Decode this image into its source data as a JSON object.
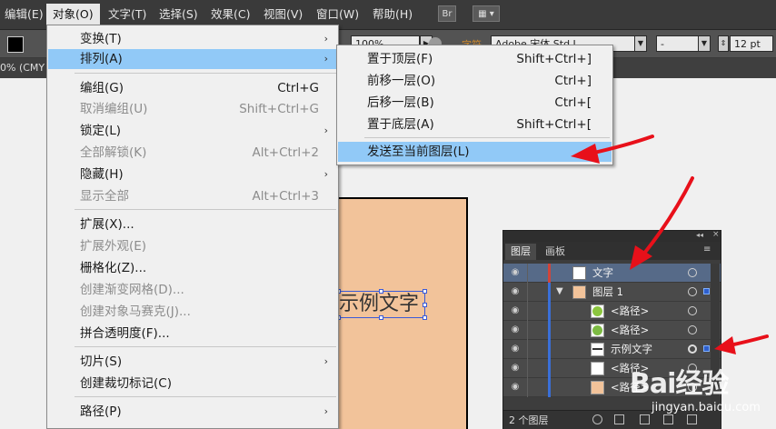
{
  "menubar": {
    "items": [
      "编辑(E)",
      "对象(O)",
      "文字(T)",
      "选择(S)",
      "效果(C)",
      "视图(V)",
      "窗口(W)",
      "帮助(H)"
    ],
    "bridge_icon": "Br",
    "arrange_icon": "workspace-icon"
  },
  "controlbar": {
    "opacity": "100%",
    "char_label": "字符",
    "font_name": "Adobe 宋体 Std L",
    "font_style": "-",
    "font_size": "12 pt"
  },
  "doc_tab": "0% (CMY",
  "sample_text": "示例文字",
  "object_menu": {
    "items": [
      {
        "label": "变换(T)",
        "shortcut": "",
        "submenu": true,
        "disabled": false
      },
      {
        "label": "排列(A)",
        "shortcut": "",
        "submenu": true,
        "disabled": false,
        "highlight": true
      },
      {
        "label": "编组(G)",
        "shortcut": "Ctrl+G",
        "submenu": false,
        "disabled": false
      },
      {
        "label": "取消编组(U)",
        "shortcut": "Shift+Ctrl+G",
        "submenu": false,
        "disabled": true
      },
      {
        "label": "锁定(L)",
        "shortcut": "",
        "submenu": true,
        "disabled": false
      },
      {
        "label": "全部解锁(K)",
        "shortcut": "Alt+Ctrl+2",
        "submenu": false,
        "disabled": true
      },
      {
        "label": "隐藏(H)",
        "shortcut": "",
        "submenu": true,
        "disabled": false
      },
      {
        "label": "显示全部",
        "shortcut": "Alt+Ctrl+3",
        "submenu": false,
        "disabled": true
      },
      {
        "label": "扩展(X)...",
        "shortcut": "",
        "submenu": false,
        "disabled": false
      },
      {
        "label": "扩展外观(E)",
        "shortcut": "",
        "submenu": false,
        "disabled": true
      },
      {
        "label": "栅格化(Z)...",
        "shortcut": "",
        "submenu": false,
        "disabled": false
      },
      {
        "label": "创建渐变网格(D)...",
        "shortcut": "",
        "submenu": false,
        "disabled": true
      },
      {
        "label": "创建对象马赛克(J)...",
        "shortcut": "",
        "submenu": false,
        "disabled": true
      },
      {
        "label": "拼合透明度(F)...",
        "shortcut": "",
        "submenu": false,
        "disabled": false
      },
      {
        "label": "切片(S)",
        "shortcut": "",
        "submenu": true,
        "disabled": false
      },
      {
        "label": "创建裁切标记(C)",
        "shortcut": "",
        "submenu": false,
        "disabled": false
      },
      {
        "label": "路径(P)",
        "shortcut": "",
        "submenu": true,
        "disabled": false
      }
    ]
  },
  "arrange_submenu": {
    "items": [
      {
        "label": "置于顶层(F)",
        "shortcut": "Shift+Ctrl+]"
      },
      {
        "label": "前移一层(O)",
        "shortcut": "Ctrl+]"
      },
      {
        "label": "后移一层(B)",
        "shortcut": "Ctrl+["
      },
      {
        "label": "置于底层(A)",
        "shortcut": "Shift+Ctrl+["
      },
      {
        "label": "发送至当前图层(L)",
        "shortcut": "",
        "highlight": true
      }
    ]
  },
  "layers_panel": {
    "tabs": [
      "图层",
      "画板"
    ],
    "rows": [
      {
        "name": "文字",
        "type": "layer",
        "selected": true
      },
      {
        "name": "图层 1",
        "type": "layer",
        "expanded": true
      },
      {
        "name": "<路径>",
        "type": "path"
      },
      {
        "name": "<路径>",
        "type": "path"
      },
      {
        "name": "示例文字",
        "type": "text",
        "selected_object": true
      },
      {
        "name": "<路径>",
        "type": "path"
      },
      {
        "name": "<路径>",
        "type": "path"
      }
    ],
    "footer_count": "2 个图层"
  },
  "watermark": {
    "brand": "Bai经验",
    "site": "jingyan.baidu.com"
  },
  "colors": {
    "highlight": "#91c9f7",
    "artboard_fill": "#f2c39a",
    "arrow": "#e8101a",
    "layer_color_text": "#d0453a",
    "layer_color_1": "#3a6fd8"
  }
}
